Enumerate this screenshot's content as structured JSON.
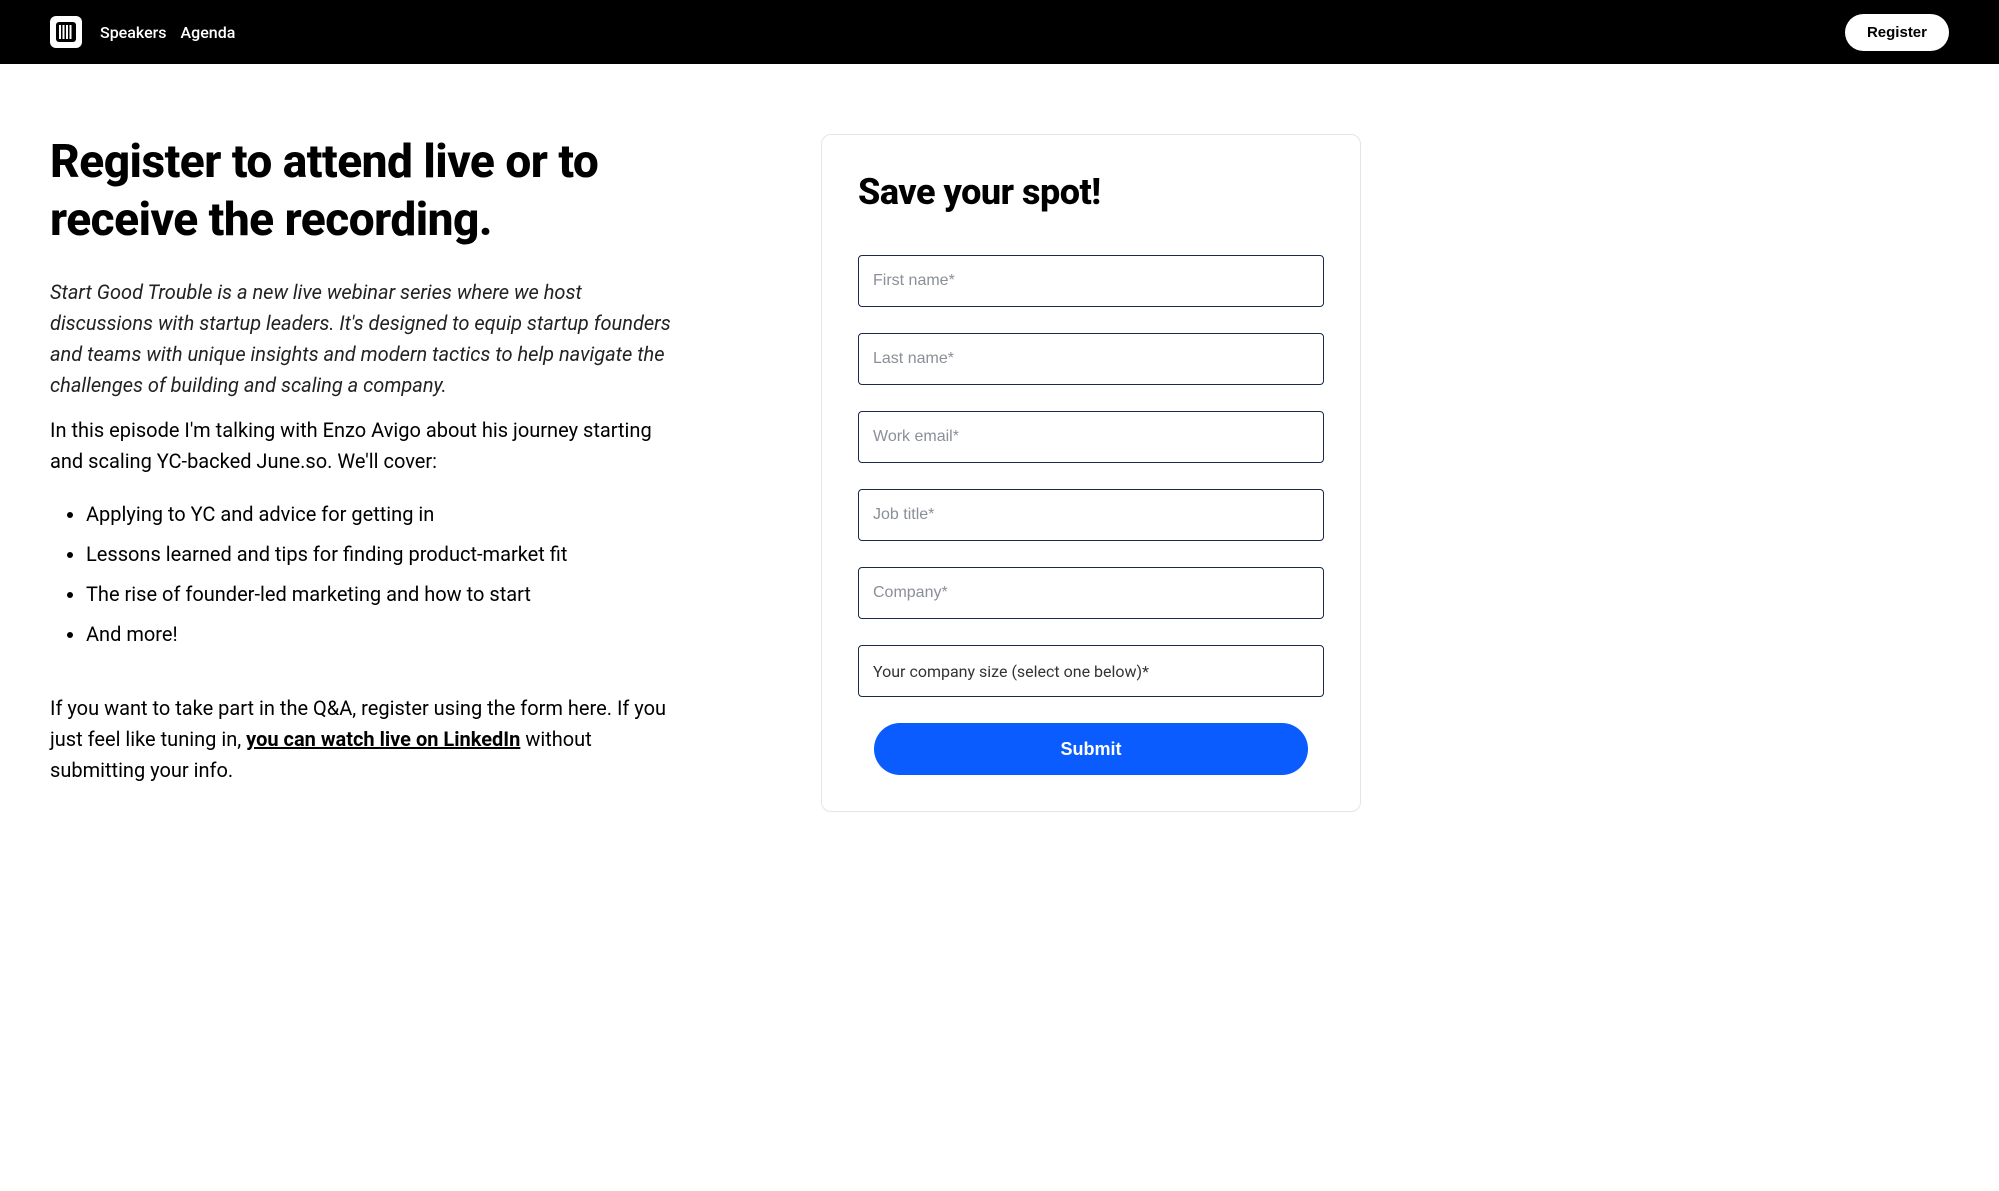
{
  "nav": {
    "links": [
      "Speakers",
      "Agenda"
    ],
    "register_label": "Register"
  },
  "main": {
    "heading": "Register to attend live or to receive the recording.",
    "intro_italic": "Start Good Trouble is a new live webinar series where we host discussions with startup leaders. It's designed to equip startup founders and teams with unique insights and modern tactics to help navigate the challenges of building and scaling a company.",
    "intro_normal": "In this episode I'm talking with Enzo Avigo about his journey starting and scaling YC-backed June.so. We'll cover:",
    "bullets": [
      "Applying to YC and advice for getting in",
      "Lessons learned and tips for finding product-market fit",
      "The rise of founder-led marketing and how to start",
      "And more!"
    ],
    "closing_before": "If you want to take part in the Q&A, register using the form here. If you just feel like tuning in, ",
    "closing_link": "you can watch live on LinkedIn",
    "closing_after": " without submitting your info."
  },
  "form": {
    "title": "Save your spot!",
    "fields": {
      "first_name_placeholder": "First name*",
      "last_name_placeholder": "Last name*",
      "work_email_placeholder": "Work email*",
      "job_title_placeholder": "Job title*",
      "company_placeholder": "Company*",
      "company_size_label": "Your company size (select one below)*"
    },
    "submit_label": "Submit"
  }
}
